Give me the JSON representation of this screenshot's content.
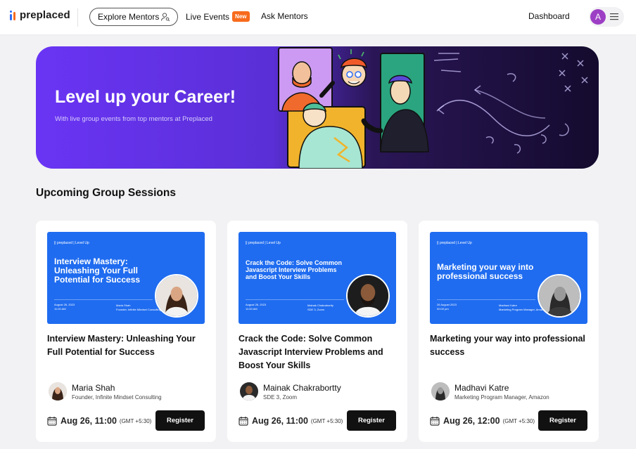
{
  "header": {
    "logo_text": "preplaced",
    "explore_label": "Explore Mentors",
    "live_label": "Live Events",
    "new_badge": "New",
    "ask_label": "Ask Mentors",
    "dashboard_label": "Dashboard",
    "avatar_letter": "A"
  },
  "hero": {
    "title": "Level up your Career!",
    "subtitle": "With live group events from top mentors at Preplaced"
  },
  "section": {
    "title": "Upcoming Group Sessions"
  },
  "cards": [
    {
      "thumb_brand": "|| preplaced | Level Up",
      "thumb_title": "Interview Mastery: Unleashing Your Full Potential for Success",
      "thumb_date": "August 26, 2023",
      "thumb_time": "11:00 AM",
      "thumb_mentor": "Maria Shah",
      "thumb_role": "Founder, Infinite Mindset Consulting",
      "title": "Interview Mastery: Unleashing Your Full Potential for Success",
      "host_name": "Maria Shah",
      "host_role": "Founder, Infinite Mindset Consulting",
      "date": "Aug 26, 11:00",
      "tz": "(GMT +5:30)",
      "register_label": "Register"
    },
    {
      "thumb_brand": "|| preplaced | Level Up",
      "thumb_title": "Crack the Code: Solve Common Javascript Interview Problems and Boost Your Skills",
      "thumb_date": "August 26, 2023",
      "thumb_time": "11:00 AM",
      "thumb_mentor": "Mainak Chakrabortty",
      "thumb_role": "SDE 3, Zoom",
      "title": "Crack the Code: Solve Common Javascript Interview Problems and Boost Your Skills",
      "host_name": "Mainak Chakrabortty",
      "host_role": "SDE 3, Zoom",
      "date": "Aug 26, 11:00",
      "tz": "(GMT +5:30)",
      "register_label": "Register"
    },
    {
      "thumb_brand": "|| preplaced | Level Up",
      "thumb_title": "Marketing your way into professional success",
      "thumb_date": "26 August 2023",
      "thumb_time": "00:00 pm",
      "thumb_mentor": "Madhavi Katre",
      "thumb_role": "Marketing Program Manager, Amazon",
      "title": "Marketing your way into professional success",
      "host_name": "Madhavi Katre",
      "host_role": "Marketing Program Manager, Amazon",
      "date": "Aug 26, 12:00",
      "tz": "(GMT +5:30)",
      "register_label": "Register"
    }
  ],
  "colors": {
    "brand_blue": "#2b6cf6",
    "brand_orange": "#f76b1c",
    "hero_purple": "#6a34f4",
    "thumb_blue": "#1f6cf0",
    "button_dark": "#111111",
    "avatar_purple": "#9d3fc5"
  }
}
